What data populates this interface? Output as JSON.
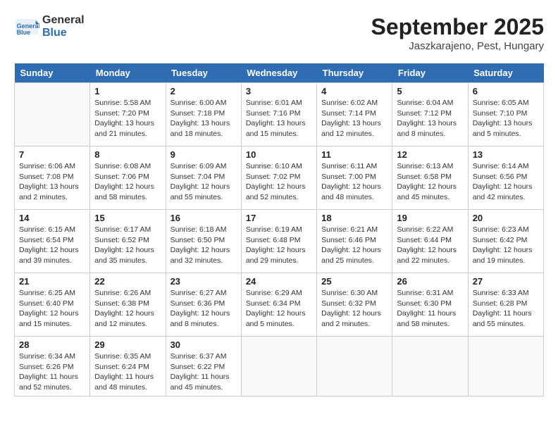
{
  "header": {
    "logo_line1": "General",
    "logo_line2": "Blue",
    "month": "September 2025",
    "location": "Jaszkarajeno, Pest, Hungary"
  },
  "weekdays": [
    "Sunday",
    "Monday",
    "Tuesday",
    "Wednesday",
    "Thursday",
    "Friday",
    "Saturday"
  ],
  "weeks": [
    [
      {
        "day": "",
        "info": ""
      },
      {
        "day": "1",
        "info": "Sunrise: 5:58 AM\nSunset: 7:20 PM\nDaylight: 13 hours\nand 21 minutes."
      },
      {
        "day": "2",
        "info": "Sunrise: 6:00 AM\nSunset: 7:18 PM\nDaylight: 13 hours\nand 18 minutes."
      },
      {
        "day": "3",
        "info": "Sunrise: 6:01 AM\nSunset: 7:16 PM\nDaylight: 13 hours\nand 15 minutes."
      },
      {
        "day": "4",
        "info": "Sunrise: 6:02 AM\nSunset: 7:14 PM\nDaylight: 13 hours\nand 12 minutes."
      },
      {
        "day": "5",
        "info": "Sunrise: 6:04 AM\nSunset: 7:12 PM\nDaylight: 13 hours\nand 8 minutes."
      },
      {
        "day": "6",
        "info": "Sunrise: 6:05 AM\nSunset: 7:10 PM\nDaylight: 13 hours\nand 5 minutes."
      }
    ],
    [
      {
        "day": "7",
        "info": "Sunrise: 6:06 AM\nSunset: 7:08 PM\nDaylight: 13 hours\nand 2 minutes."
      },
      {
        "day": "8",
        "info": "Sunrise: 6:08 AM\nSunset: 7:06 PM\nDaylight: 12 hours\nand 58 minutes."
      },
      {
        "day": "9",
        "info": "Sunrise: 6:09 AM\nSunset: 7:04 PM\nDaylight: 12 hours\nand 55 minutes."
      },
      {
        "day": "10",
        "info": "Sunrise: 6:10 AM\nSunset: 7:02 PM\nDaylight: 12 hours\nand 52 minutes."
      },
      {
        "day": "11",
        "info": "Sunrise: 6:11 AM\nSunset: 7:00 PM\nDaylight: 12 hours\nand 48 minutes."
      },
      {
        "day": "12",
        "info": "Sunrise: 6:13 AM\nSunset: 6:58 PM\nDaylight: 12 hours\nand 45 minutes."
      },
      {
        "day": "13",
        "info": "Sunrise: 6:14 AM\nSunset: 6:56 PM\nDaylight: 12 hours\nand 42 minutes."
      }
    ],
    [
      {
        "day": "14",
        "info": "Sunrise: 6:15 AM\nSunset: 6:54 PM\nDaylight: 12 hours\nand 39 minutes."
      },
      {
        "day": "15",
        "info": "Sunrise: 6:17 AM\nSunset: 6:52 PM\nDaylight: 12 hours\nand 35 minutes."
      },
      {
        "day": "16",
        "info": "Sunrise: 6:18 AM\nSunset: 6:50 PM\nDaylight: 12 hours\nand 32 minutes."
      },
      {
        "day": "17",
        "info": "Sunrise: 6:19 AM\nSunset: 6:48 PM\nDaylight: 12 hours\nand 29 minutes."
      },
      {
        "day": "18",
        "info": "Sunrise: 6:21 AM\nSunset: 6:46 PM\nDaylight: 12 hours\nand 25 minutes."
      },
      {
        "day": "19",
        "info": "Sunrise: 6:22 AM\nSunset: 6:44 PM\nDaylight: 12 hours\nand 22 minutes."
      },
      {
        "day": "20",
        "info": "Sunrise: 6:23 AM\nSunset: 6:42 PM\nDaylight: 12 hours\nand 19 minutes."
      }
    ],
    [
      {
        "day": "21",
        "info": "Sunrise: 6:25 AM\nSunset: 6:40 PM\nDaylight: 12 hours\nand 15 minutes."
      },
      {
        "day": "22",
        "info": "Sunrise: 6:26 AM\nSunset: 6:38 PM\nDaylight: 12 hours\nand 12 minutes."
      },
      {
        "day": "23",
        "info": "Sunrise: 6:27 AM\nSunset: 6:36 PM\nDaylight: 12 hours\nand 8 minutes."
      },
      {
        "day": "24",
        "info": "Sunrise: 6:29 AM\nSunset: 6:34 PM\nDaylight: 12 hours\nand 5 minutes."
      },
      {
        "day": "25",
        "info": "Sunrise: 6:30 AM\nSunset: 6:32 PM\nDaylight: 12 hours\nand 2 minutes."
      },
      {
        "day": "26",
        "info": "Sunrise: 6:31 AM\nSunset: 6:30 PM\nDaylight: 11 hours\nand 58 minutes."
      },
      {
        "day": "27",
        "info": "Sunrise: 6:33 AM\nSunset: 6:28 PM\nDaylight: 11 hours\nand 55 minutes."
      }
    ],
    [
      {
        "day": "28",
        "info": "Sunrise: 6:34 AM\nSunset: 6:26 PM\nDaylight: 11 hours\nand 52 minutes."
      },
      {
        "day": "29",
        "info": "Sunrise: 6:35 AM\nSunset: 6:24 PM\nDaylight: 11 hours\nand 48 minutes."
      },
      {
        "day": "30",
        "info": "Sunrise: 6:37 AM\nSunset: 6:22 PM\nDaylight: 11 hours\nand 45 minutes."
      },
      {
        "day": "",
        "info": ""
      },
      {
        "day": "",
        "info": ""
      },
      {
        "day": "",
        "info": ""
      },
      {
        "day": "",
        "info": ""
      }
    ]
  ]
}
